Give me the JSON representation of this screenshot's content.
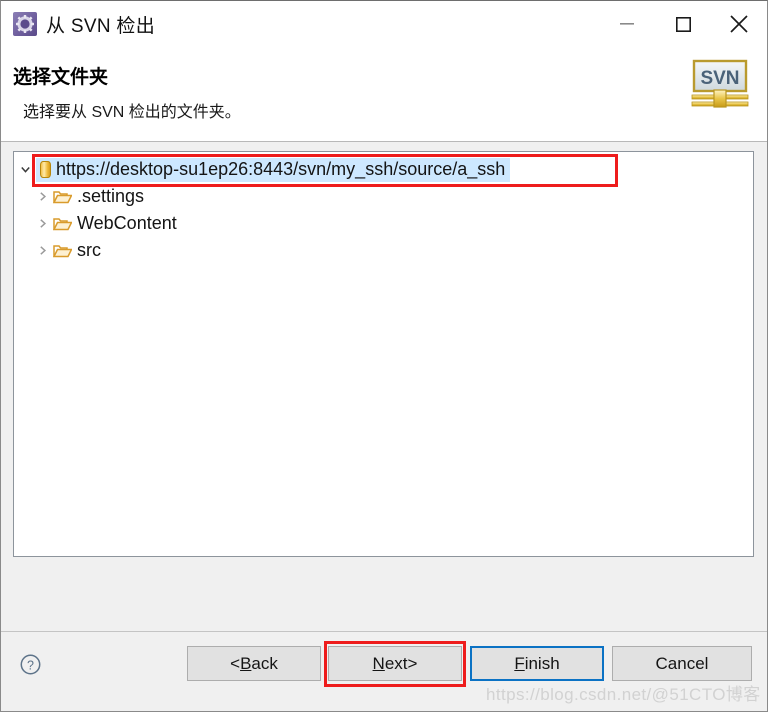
{
  "window": {
    "title": "从 SVN 检出",
    "icon": "svn-gear-icon",
    "controls": {
      "minimize": "minimize-icon",
      "maximize": "maximize-icon",
      "close": "close-icon"
    }
  },
  "header": {
    "title": "选择文件夹",
    "description": "选择要从 SVN 检出的文件夹。",
    "logo_text": "SVN"
  },
  "tree": {
    "root": {
      "label": "https://desktop-su1ep26:8443/svn/my_ssh/source/a_ssh",
      "icon": "repository-icon",
      "expanded": true,
      "selected": true
    },
    "children": [
      {
        "label": ".settings",
        "icon": "folder-icon",
        "expanded": false
      },
      {
        "label": "WebContent",
        "icon": "folder-icon",
        "expanded": false
      },
      {
        "label": "src",
        "icon": "folder-icon",
        "expanded": false
      }
    ]
  },
  "footer": {
    "help": "help-icon",
    "buttons": {
      "back": {
        "prefix": "< ",
        "accel": "B",
        "rest": "ack",
        "suffix": ""
      },
      "next": {
        "prefix": "",
        "accel": "N",
        "rest": "ext",
        "suffix": " >"
      },
      "finish": {
        "prefix": "",
        "accel": "F",
        "rest": "inish",
        "suffix": ""
      },
      "cancel": {
        "prefix": "",
        "accel": "",
        "rest": "Cancel",
        "suffix": ""
      }
    },
    "watermark": "https://blog.csdn.net/@51CTO博客"
  },
  "colors": {
    "annotation": "#ee1c1c",
    "focus_border": "#0b72c4",
    "selection_bg": "#cde8ff",
    "dialog_bg": "#f0f0f0",
    "panel_bg": "#ffffff"
  }
}
